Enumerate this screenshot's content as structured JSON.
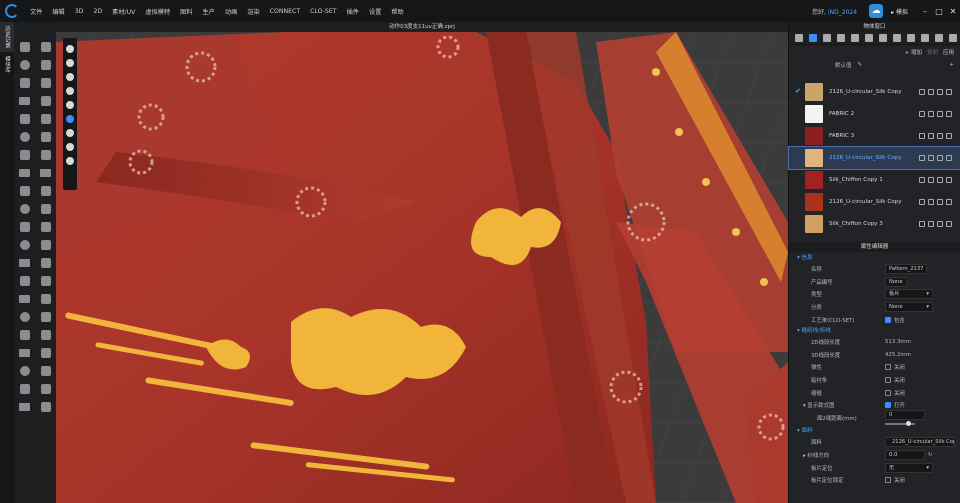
{
  "menubar": {
    "items": [
      "文件",
      "编辑",
      "3D",
      "2D",
      "素材/UV",
      "虚拟模特",
      "图料",
      "生产",
      "动画",
      "渲染",
      "CONNECT",
      "CLO-SET",
      "插件",
      "设置",
      "帮助"
    ],
    "user_label": "您好,",
    "user_name": "iND_2024",
    "sim_label": "模拟"
  },
  "left_tabs": [
    "历史记录",
    "模块库"
  ],
  "viewport": {
    "title": "动作03度支11uv正确.zprj"
  },
  "right_panel": {
    "object_window_title": "物体窗口",
    "add_label": "+ 增加",
    "copy_label": "复制",
    "apply_label": "应用",
    "sort_label": "默认值",
    "fabrics": [
      {
        "name": "2126_U-circular_Silk Copy",
        "color": "#c9a46b",
        "checked": true,
        "selected": false
      },
      {
        "name": "FABRIC 2",
        "color": "#f3f3f1",
        "checked": false,
        "selected": false
      },
      {
        "name": "FABRIC 3",
        "color": "#8f1f1c",
        "checked": false,
        "selected": false
      },
      {
        "name": "2126_U-circular_Silk Copy",
        "color": "#e2b47d",
        "checked": false,
        "selected": true
      },
      {
        "name": "Silk_Chiffon Copy 1",
        "color": "#a3211f",
        "checked": false,
        "selected": false
      },
      {
        "name": "2126_U-circular_Silk Copy",
        "color": "#a8321c",
        "checked": false,
        "selected": false
      },
      {
        "name": "Silk_Chiffon Copy 3",
        "color": "#cfa163",
        "checked": false,
        "selected": false
      }
    ],
    "property_editor_title": "属性编辑器",
    "sections": {
      "info": "信息",
      "line": "缝纫线/折线",
      "fabric": "面料"
    },
    "info_rows": [
      {
        "label": "名称",
        "value": "Pattern_2137"
      },
      {
        "label": "产品编号",
        "value": "None"
      },
      {
        "label": "类型",
        "value": "板片"
      },
      {
        "label": "分类",
        "value": "None"
      },
      {
        "label": "工艺单(CLO-SET)",
        "value": "包含"
      }
    ],
    "line_rows": [
      {
        "label": "2D线段长度",
        "value": "513.3mm"
      },
      {
        "label": "3D线段长度",
        "value": "425.2mm"
      },
      {
        "label": "弹性",
        "value": "关闭"
      },
      {
        "label": "粘衬条",
        "value": "关闭"
      },
      {
        "label": "缩缝",
        "value": "关闭"
      }
    ],
    "display": {
      "label": "显示款式图",
      "value": "打开"
    },
    "spacing": {
      "label": "面2缝距离(mm)",
      "value": "0"
    },
    "fabric_rows": {
      "fabric_label": "面料",
      "fabric_value": "2126_U-circular_Silk Copy",
      "grain_label": "纱线方向",
      "grain_value": "0.0",
      "pos_label": "板片定位",
      "pos_value": "无",
      "lock_label": "板片定位锁定",
      "lock_value": "关闭"
    }
  }
}
